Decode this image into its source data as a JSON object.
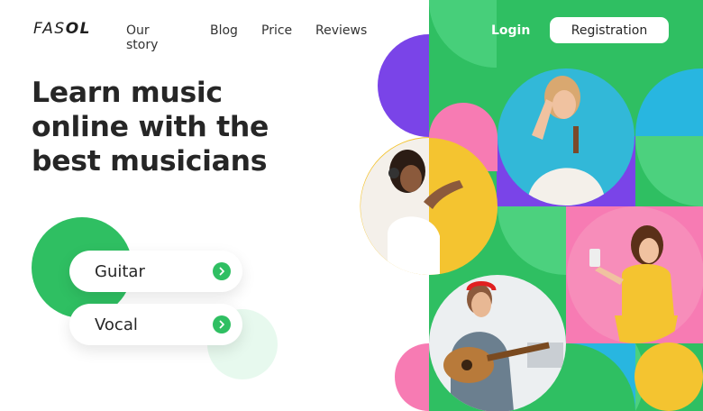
{
  "brand": {
    "logo_text_left": "FAS",
    "logo_text_right": "OL"
  },
  "nav": {
    "items": [
      {
        "label": "Our story"
      },
      {
        "label": "Blog"
      },
      {
        "label": "Price"
      },
      {
        "label": "Reviews"
      }
    ]
  },
  "auth": {
    "login_label": "Login",
    "registration_label": "Registration"
  },
  "hero": {
    "headline_line1": "Learn music",
    "headline_line2": "online with the",
    "headline_line3": "best musicians"
  },
  "courses": [
    {
      "label": "Guitar",
      "icon": "chevron-right-icon"
    },
    {
      "label": "Vocal",
      "icon": "chevron-right-icon"
    }
  ],
  "colors": {
    "brand_green": "#2fbf62",
    "purple": "#7a44e8",
    "pink": "#f77bb3",
    "yellow": "#f4c430",
    "cyan": "#28b6e0",
    "mint": "#e7f9ee"
  },
  "images": [
    {
      "name": "girl-with-headphones-photo"
    },
    {
      "name": "girl-peace-sign-photo"
    },
    {
      "name": "girl-dancing-phone-photo"
    },
    {
      "name": "man-playing-guitar-photo"
    }
  ]
}
